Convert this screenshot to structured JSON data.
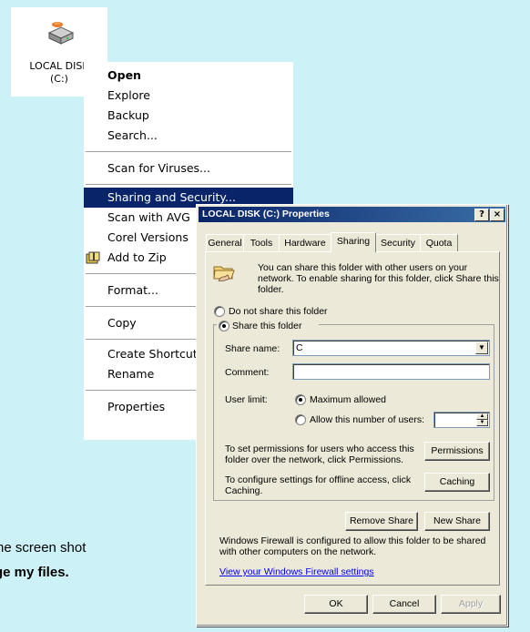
{
  "desktop": {
    "disk_label_line1": "LOCAL DISK",
    "disk_label_line2": "(C:)",
    "disk_icon": "drive-icon"
  },
  "caption": {
    "line1": "he screen shot",
    "line2": "ge my files."
  },
  "context_menu": {
    "items": [
      {
        "label": "Open"
      },
      {
        "label": "Explore"
      },
      {
        "label": "Backup"
      },
      {
        "label": "Search..."
      },
      {
        "label": "Scan for Viruses..."
      },
      {
        "label": "Sharing and Security..."
      },
      {
        "label": "Scan with AVG"
      },
      {
        "label": "Corel Versions"
      },
      {
        "label": "Add to Zip"
      },
      {
        "label": "Format..."
      },
      {
        "label": "Copy"
      },
      {
        "label": "Create Shortcut"
      },
      {
        "label": "Rename"
      },
      {
        "label": "Properties"
      }
    ]
  },
  "dialog": {
    "title": "LOCAL DISK (C:) Properties",
    "help_btn": "?",
    "close_btn": "×",
    "tabs": [
      "General",
      "Tools",
      "Hardware",
      "Sharing",
      "Security",
      "Quota"
    ],
    "active_tab": "Sharing",
    "intro": [
      "You can share this folder with other users on your",
      "network.  To enable sharing for this folder, click Share this",
      "folder."
    ],
    "radio_no_share": "Do not share this folder",
    "radio_share": "Share this folder",
    "share_name_label": "Share name:",
    "share_name_value": "C",
    "comment_label": "Comment:",
    "comment_value": "",
    "user_limit_label": "User limit:",
    "radio_max": "Maximum allowed",
    "radio_allow": "Allow this number of users:",
    "perm_text": [
      "To set permissions for users who access this",
      "folder over the network, click Permissions."
    ],
    "perm_btn": "Permissions",
    "cache_text": [
      "To configure settings for offline access, click",
      "Caching."
    ],
    "cache_btn": "Caching",
    "remove_btn": "Remove Share",
    "new_btn": "New Share",
    "firewall_text": [
      "Windows Firewall is configured to allow this folder to be shared",
      "with other computers on the network."
    ],
    "firewall_link": "View your Windows Firewall settings",
    "ok": "OK",
    "cancel": "Cancel",
    "apply": "Apply"
  }
}
